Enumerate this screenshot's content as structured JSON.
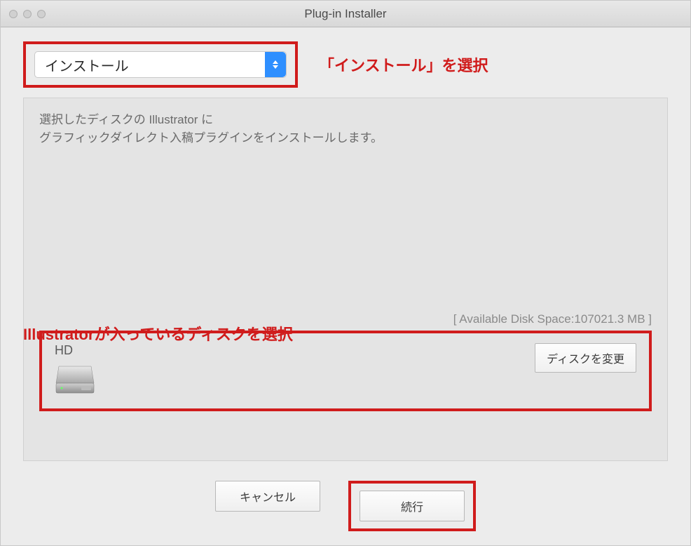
{
  "window": {
    "title": "Plug-in Installer"
  },
  "dropdown": {
    "selected": "インストール"
  },
  "annotations": {
    "select_install": "「インストール」を選択",
    "select_disk": "Illustratorが入っているディスクを選択"
  },
  "description": {
    "line1": "選択したディスクの Illustrator に",
    "line2": "グラフィックダイレクト入稿プラグインをインストールします。"
  },
  "disk": {
    "available_space": "[ Available Disk Space:107021.3 MB ]",
    "name": "HD",
    "change_button": "ディスクを変更"
  },
  "buttons": {
    "cancel": "キャンセル",
    "continue": "続行"
  }
}
